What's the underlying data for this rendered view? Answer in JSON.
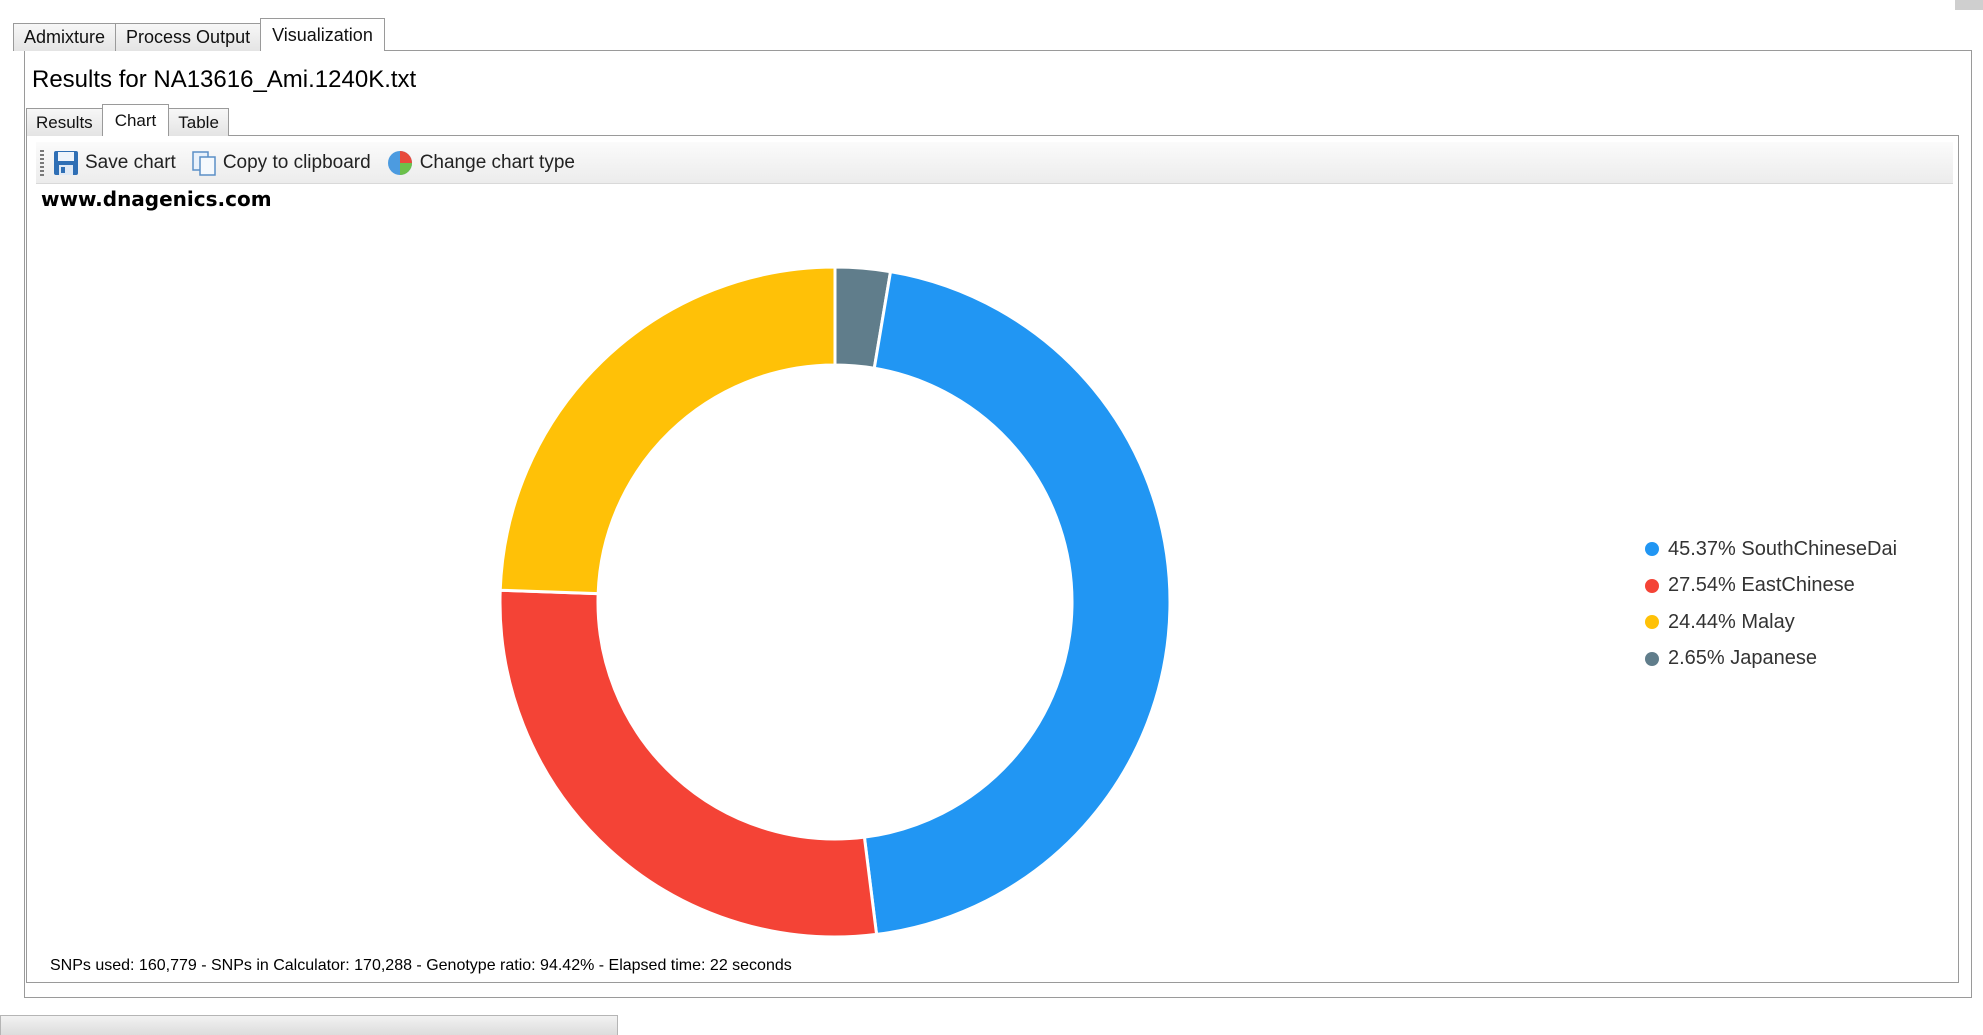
{
  "outer_tabs": [
    {
      "label": "Admixture",
      "active": false
    },
    {
      "label": "Process Output",
      "active": false
    },
    {
      "label": "Visualization",
      "active": true
    }
  ],
  "results_title": "Results for NA13616_Ami.1240K.txt",
  "inner_tabs": [
    {
      "label": "Results",
      "active": false
    },
    {
      "label": "Chart",
      "active": true
    },
    {
      "label": "Table",
      "active": false
    }
  ],
  "toolbar": {
    "save_label": "Save chart",
    "copy_label": "Copy to clipboard",
    "change_type_label": "Change chart type",
    "save_icon": "floppy-disk-icon",
    "copy_icon": "copy-icon",
    "change_type_icon": "pie-chart-icon"
  },
  "watermark": "www.dnagenics.com",
  "chart_data": {
    "type": "pie",
    "donut": true,
    "start": "top",
    "direction": "clockwise",
    "legend_position": "right",
    "slices": [
      {
        "label": "Japanese",
        "value": 2.65,
        "color": "#607d8b"
      },
      {
        "label": "SouthChineseDai",
        "value": 45.37,
        "color": "#2196f3"
      },
      {
        "label": "EastChinese",
        "value": 27.54,
        "color": "#f44336"
      },
      {
        "label": "Malay",
        "value": 24.44,
        "color": "#ffc107"
      }
    ],
    "legend": [
      {
        "text": "45.37% SouthChineseDai",
        "color": "#2196f3"
      },
      {
        "text": "27.54% EastChinese",
        "color": "#f44336"
      },
      {
        "text": "24.44% Malay",
        "color": "#ffc107"
      },
      {
        "text": "2.65% Japanese",
        "color": "#607d8b"
      }
    ]
  },
  "status_line": "SNPs used: 160,779 - SNPs in Calculator: 170,288 - Genotype ratio: 94.42% - Elapsed time: 22 seconds"
}
